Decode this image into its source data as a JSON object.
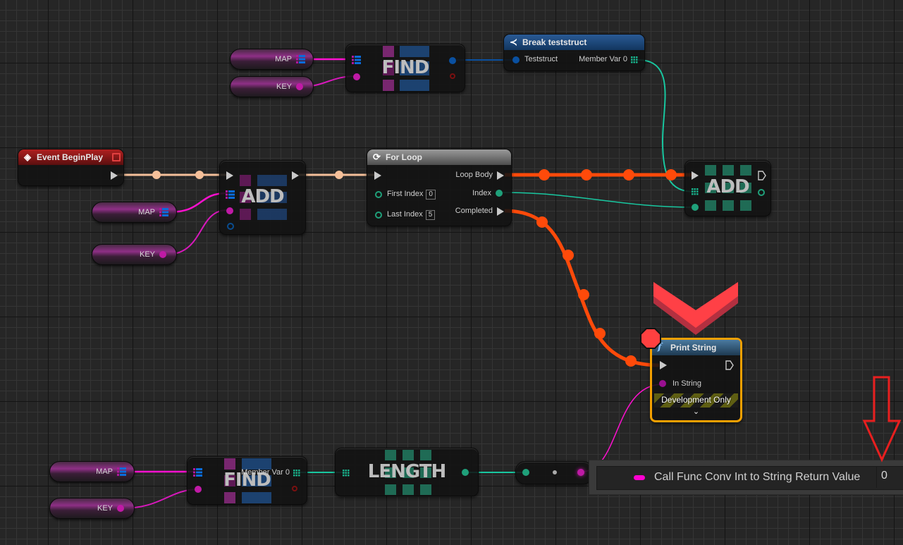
{
  "graph": {
    "nodes": {
      "find_top": {
        "label": "FIND",
        "map_var": "MAP",
        "key_var": "KEY"
      },
      "break_struct": {
        "title": "Break teststruct",
        "input": "Teststruct",
        "output": "Member Var 0"
      },
      "event_begin_play": {
        "title": "Event BeginPlay"
      },
      "add_map": {
        "label": "ADD",
        "map_var": "MAP",
        "key_var": "KEY"
      },
      "for_loop": {
        "title": "For Loop",
        "inputs": [
          {
            "label": "First Index",
            "value": "0"
          },
          {
            "label": "Last Index",
            "value": "5"
          }
        ],
        "outputs": [
          "Loop Body",
          "Index",
          "Completed"
        ]
      },
      "add_array": {
        "label": "ADD"
      },
      "print_string": {
        "title": "Print String",
        "input": "In String",
        "footer": "Development Only",
        "breakpoint": true
      },
      "find_bottom": {
        "label": "FIND",
        "output": "Member Var 0",
        "map_var": "MAP",
        "key_var": "KEY"
      },
      "length": {
        "label": "LENGTH"
      }
    },
    "colors": {
      "exec_active": "#ff4a0a",
      "exec_idle": "#f5c09a",
      "map_pin": "#0a6cdc",
      "name_pin": "#c81fb4",
      "int_pin": "#1fa07a",
      "struct_pin": "#0a4d8f",
      "string_pin": "#ff00d0",
      "breakpoint": "#ff4040",
      "highlight": "#f3a000",
      "annotation": "#e81f1f"
    }
  },
  "watch_tooltip": {
    "label": "Call Func Conv Int to String Return Value",
    "value": "0"
  }
}
